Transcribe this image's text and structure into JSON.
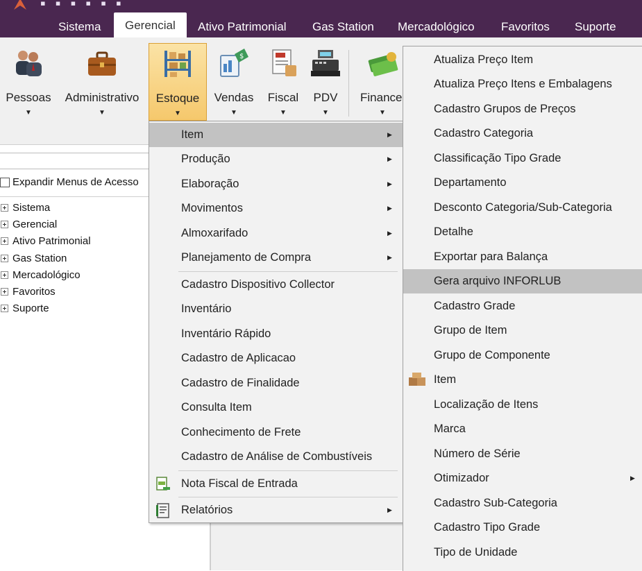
{
  "tabs": [
    "Sistema",
    "Gerencial",
    "Ativo Patrimonial",
    "Gas Station",
    "Mercadológico",
    "Favoritos",
    "Suporte"
  ],
  "active_tab": "Gerencial",
  "ribbon": {
    "buttons": [
      "Pessoas",
      "Administrativo",
      "Estoque",
      "Vendas",
      "Fiscal",
      "PDV",
      "Financei"
    ],
    "selected": "Estoque"
  },
  "left_panel": {
    "expand_label": "Expandir Menus de Acesso",
    "tree": [
      "Sistema",
      "Gerencial",
      "Ativo Patrimonial",
      "Gas Station",
      "Mercadológico",
      "Favoritos",
      "Suporte"
    ]
  },
  "estoque_menu": {
    "items": [
      "Item",
      "Produção",
      "Elaboração",
      "Movimentos",
      "Almoxarifado",
      "Planejamento de Compra",
      "Cadastro Dispositivo Collector",
      "Inventário",
      "Inventário Rápido",
      "Cadastro de Aplicacao",
      "Cadastro de Finalidade",
      "Consulta Item",
      "Conhecimento de Frete",
      "Cadastro de Análise de Combustíveis",
      "Nota Fiscal de Entrada",
      "Relatórios"
    ],
    "highlighted": "Item"
  },
  "item_submenu": {
    "items": [
      "Atualiza Preço Item",
      "Atualiza Preço Itens e Embalagens",
      "Cadastro Grupos de Preços",
      "Cadastro Categoria",
      "Classificação Tipo Grade",
      "Departamento",
      "Desconto Categoria/Sub-Categoria",
      "Detalhe",
      "Exportar para Balança",
      "Gera arquivo INFORLUB",
      "Cadastro Grade",
      "Grupo de Item",
      "Grupo de Componente",
      "Item",
      "Localização de Itens",
      "Marca",
      "Número de Série",
      "Otimizador",
      "Cadastro Sub-Categoria",
      "Cadastro Tipo Grade",
      "Tipo de Unidade"
    ],
    "highlighted": "Gera arquivo INFORLUB"
  },
  "colors": {
    "titlebar": "#4a2750",
    "highlight": "#c2c2c2",
    "ribbon_selected": "#f5c86c"
  }
}
